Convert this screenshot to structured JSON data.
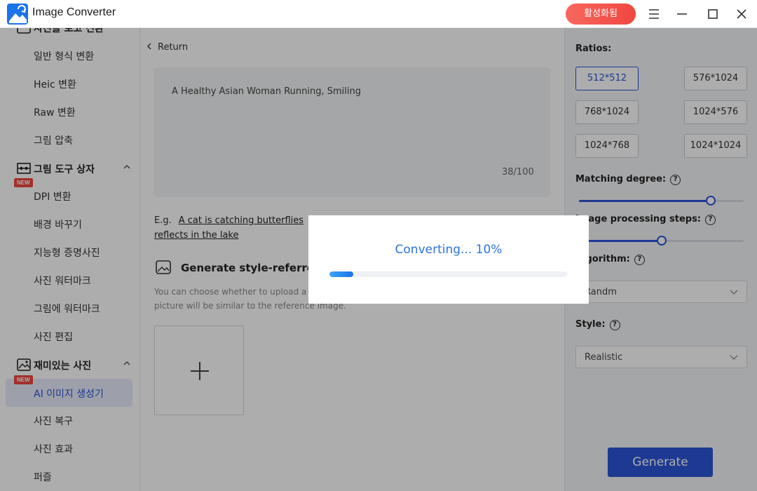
{
  "app": {
    "title": "Image Converter",
    "activate_label": "활성화됨"
  },
  "sidebar": {
    "partial_top_label": "사진을 로고 전환",
    "format_items": [
      "일반 형식 변환",
      "Heic 변환",
      "Raw 변환",
      "그림 압축"
    ],
    "toolbox": {
      "label": "그림 도구 상자",
      "items": [
        "DPI 변환",
        "배경 바꾸기",
        "지능형 증명사진",
        "사진 워터마크",
        "그림에 워터마크",
        "사진 편집"
      ]
    },
    "fun": {
      "label": "재미있는 사진",
      "items": [
        "AI 이미지 생성기",
        "사진 복구",
        "사진 효과",
        "퍼즐"
      ]
    },
    "badge_new": "NEW"
  },
  "main": {
    "return_label": "Return",
    "prompt_text": "A Healthy Asian Woman Running, Smiling",
    "prompt_count": "38/100",
    "example_prefix": "E.g.",
    "example_link_1": "A cat is catching butterflies",
    "example_link_2": "reflects in the lake",
    "style_heading": "Generate style-referred pi",
    "style_desc_1": "You can choose whether to upload a p",
    "style_desc_2": "picture will be similar to the reference image."
  },
  "right": {
    "ratios_label": "Ratios:",
    "ratios": [
      "512*512",
      "576*1024",
      "768*1024",
      "1024*576",
      "1024*768",
      "1024*1024"
    ],
    "selected_ratio": "512*512",
    "matching_label": "Matching degree:",
    "matching_value": 0.8,
    "steps_label": "Image processing steps:",
    "steps_value": 0.5,
    "algorithm_label": "Algorithm:",
    "algorithm_value": "Randm",
    "style_label": "Style:",
    "style_value": "Realistic",
    "generate_label": "Generate",
    "accent": "#2b55d6"
  },
  "dialog": {
    "title": "Converting... 10%",
    "progress": 0.1
  }
}
